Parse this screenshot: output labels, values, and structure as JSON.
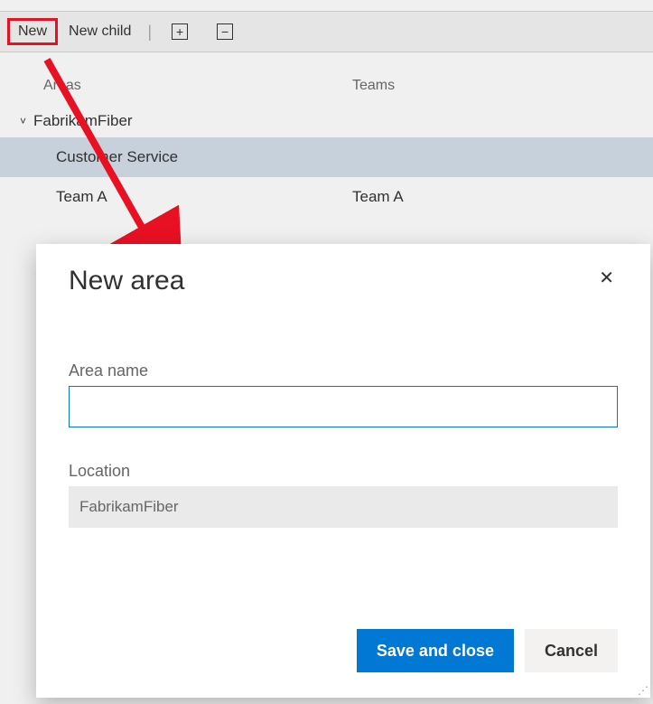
{
  "toolbar": {
    "new_label": "New",
    "new_child_label": "New child",
    "expand_glyph": "+",
    "collapse_glyph": "−"
  },
  "columns": {
    "areas": "Areas",
    "teams": "Teams"
  },
  "tree": {
    "root": {
      "label": "FabrikamFiber",
      "chevron": "˅"
    },
    "rows": [
      {
        "area": "Customer Service",
        "team": ""
      },
      {
        "area": "Team A",
        "team": "Team A"
      }
    ]
  },
  "dialog": {
    "title": "New area",
    "close_glyph": "✕",
    "area_name_label": "Area name",
    "area_name_value": "",
    "location_label": "Location",
    "location_value": "FabrikamFiber",
    "save_label": "Save and close",
    "cancel_label": "Cancel"
  }
}
